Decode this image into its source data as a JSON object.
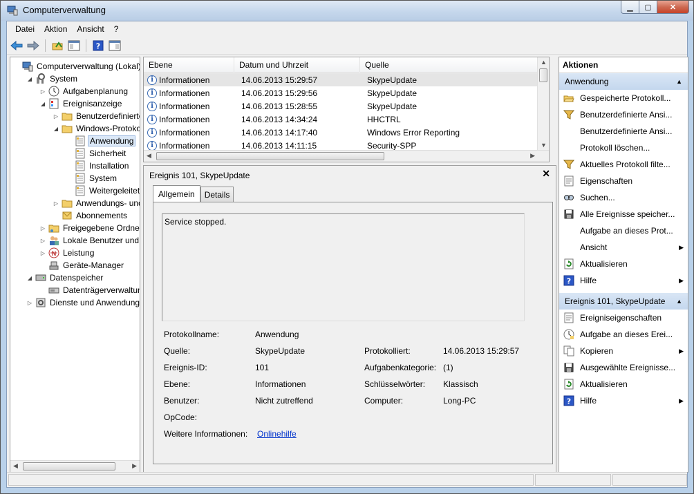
{
  "window": {
    "title": "Computerverwaltung"
  },
  "menu": [
    "Datei",
    "Aktion",
    "Ansicht",
    "?"
  ],
  "tree": [
    {
      "label": "Computerverwaltung (Lokal)",
      "level": 0,
      "exp": "",
      "icon": "computer-icon"
    },
    {
      "label": "System",
      "level": 1,
      "exp": "◢",
      "icon": "tools-icon"
    },
    {
      "label": "Aufgabenplanung",
      "level": 2,
      "exp": "▷",
      "icon": "clock-icon"
    },
    {
      "label": "Ereignisanzeige",
      "level": 2,
      "exp": "◢",
      "icon": "event-viewer-icon"
    },
    {
      "label": "Benutzerdefinierte Ansichten",
      "level": 3,
      "exp": "▷",
      "icon": "folder-icon"
    },
    {
      "label": "Windows-Protokolle",
      "level": 3,
      "exp": "◢",
      "icon": "folder-icon"
    },
    {
      "label": "Anwendung",
      "level": 4,
      "exp": "",
      "icon": "log-icon",
      "selected": true
    },
    {
      "label": "Sicherheit",
      "level": 4,
      "exp": "",
      "icon": "log-icon"
    },
    {
      "label": "Installation",
      "level": 4,
      "exp": "",
      "icon": "log-icon"
    },
    {
      "label": "System",
      "level": 4,
      "exp": "",
      "icon": "log-icon"
    },
    {
      "label": "Weitergeleitete Ereignisse",
      "level": 4,
      "exp": "",
      "icon": "log-icon"
    },
    {
      "label": "Anwendungs- und Dienstprotokolle",
      "level": 3,
      "exp": "▷",
      "icon": "folder-icon"
    },
    {
      "label": "Abonnements",
      "level": 3,
      "exp": "",
      "icon": "subscription-icon"
    },
    {
      "label": "Freigegebene Ordner",
      "level": 2,
      "exp": "▷",
      "icon": "shared-folder-icon"
    },
    {
      "label": "Lokale Benutzer und Gruppen",
      "level": 2,
      "exp": "▷",
      "icon": "users-icon"
    },
    {
      "label": "Leistung",
      "level": 2,
      "exp": "▷",
      "icon": "performance-icon"
    },
    {
      "label": "Geräte-Manager",
      "level": 2,
      "exp": "",
      "icon": "device-manager-icon"
    },
    {
      "label": "Datenspeicher",
      "level": 1,
      "exp": "◢",
      "icon": "storage-icon"
    },
    {
      "label": "Datenträgerverwaltung",
      "level": 2,
      "exp": "",
      "icon": "disk-icon"
    },
    {
      "label": "Dienste und Anwendungen",
      "level": 1,
      "exp": "▷",
      "icon": "services-icon"
    }
  ],
  "grid": {
    "columns": [
      "Ebene",
      "Datum und Uhrzeit",
      "Quelle"
    ],
    "rows": [
      {
        "level": "Informationen",
        "date": "14.06.2013 15:29:57",
        "source": "SkypeUpdate"
      },
      {
        "level": "Informationen",
        "date": "14.06.2013 15:29:56",
        "source": "SkypeUpdate"
      },
      {
        "level": "Informationen",
        "date": "14.06.2013 15:28:55",
        "source": "SkypeUpdate"
      },
      {
        "level": "Informationen",
        "date": "14.06.2013 14:34:24",
        "source": "HHCTRL"
      },
      {
        "level": "Informationen",
        "date": "14.06.2013 14:17:40",
        "source": "Windows Error Reporting"
      },
      {
        "level": "Informationen",
        "date": "14.06.2013 14:11:15",
        "source": "Security-SPP"
      }
    ]
  },
  "detail": {
    "title": "Ereignis 101, SkypeUpdate",
    "close": "✕",
    "tabs": [
      "Allgemein",
      "Details"
    ],
    "description": "Service stopped.",
    "fields": {
      "protokollname_label": "Protokollname:",
      "protokollname": "Anwendung",
      "quelle_label": "Quelle:",
      "quelle": "SkypeUpdate",
      "protokolliert_label": "Protokolliert:",
      "protokolliert": "14.06.2013 15:29:57",
      "ereignisid_label": "Ereignis-ID:",
      "ereignisid": "101",
      "aufgabenkategorie_label": "Aufgabenkategorie:",
      "aufgabenkategorie": "(1)",
      "ebene_label": "Ebene:",
      "ebene": "Informationen",
      "schluessel_label": "Schlüsselwörter:",
      "schluessel": "Klassisch",
      "benutzer_label": "Benutzer:",
      "benutzer": "Nicht zutreffend",
      "computer_label": "Computer:",
      "computer": "Long-PC",
      "opcode_label": "OpCode:",
      "weitere_label": "Weitere Informationen:",
      "weitere_link": "Onlinehilfe"
    }
  },
  "actions": {
    "header": "Aktionen",
    "section1": "Anwendung",
    "items1": [
      {
        "label": "Gespeicherte Protokoll...",
        "icon": "open-folder-icon",
        "sub": false
      },
      {
        "label": "Benutzerdefinierte Ansi...",
        "icon": "filter-icon",
        "sub": false
      },
      {
        "label": "Benutzerdefinierte Ansi...",
        "icon": "",
        "sub": false
      },
      {
        "label": "Protokoll löschen...",
        "icon": "",
        "sub": false
      },
      {
        "label": "Aktuelles Protokoll filte...",
        "icon": "filter-icon",
        "sub": false
      },
      {
        "label": "Eigenschaften",
        "icon": "properties-icon",
        "sub": false
      },
      {
        "label": "Suchen...",
        "icon": "find-icon",
        "sub": false
      },
      {
        "label": "Alle Ereignisse speicher...",
        "icon": "save-icon",
        "sub": false
      },
      {
        "label": "Aufgabe an dieses Prot...",
        "icon": "",
        "sub": false
      },
      {
        "label": "Ansicht",
        "icon": "",
        "sub": true
      },
      {
        "label": "Aktualisieren",
        "icon": "refresh-icon",
        "sub": false
      },
      {
        "label": "Hilfe",
        "icon": "help-icon",
        "sub": true
      }
    ],
    "section2": "Ereignis 101, SkypeUpdate",
    "items2": [
      {
        "label": "Ereigniseigenschaften",
        "icon": "properties-icon",
        "sub": false
      },
      {
        "label": "Aufgabe an dieses Erei...",
        "icon": "task-icon",
        "sub": false
      },
      {
        "label": "Kopieren",
        "icon": "copy-icon",
        "sub": true
      },
      {
        "label": "Ausgewählte Ereignisse...",
        "icon": "save-icon",
        "sub": false
      },
      {
        "label": "Aktualisieren",
        "icon": "refresh-icon",
        "sub": false
      },
      {
        "label": "Hilfe",
        "icon": "help-icon",
        "sub": true
      }
    ]
  },
  "colors": {
    "selection": "#dbe8f7",
    "section": "#c4d7ee",
    "link": "#0033cc"
  }
}
